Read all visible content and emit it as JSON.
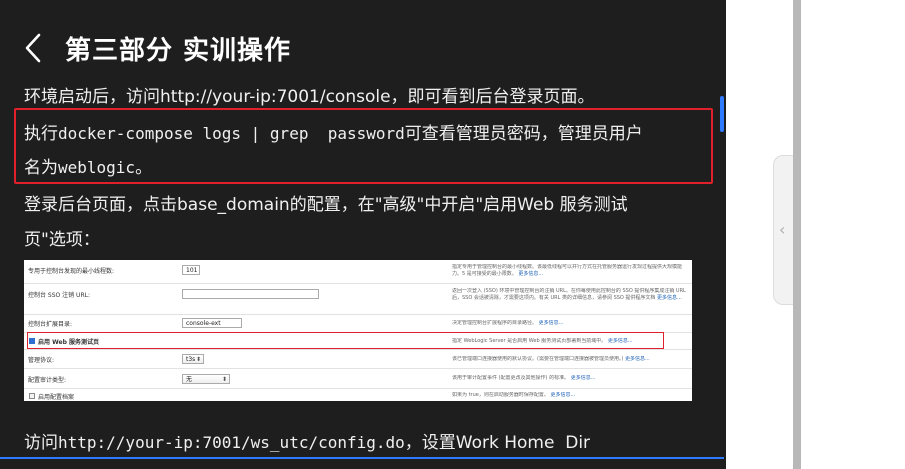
{
  "header": {
    "back_icon": "chevron-left-icon",
    "title": "第三部分 实训操作"
  },
  "content": {
    "line1": "环境启动后，访问http://your-ip:7001/console，即可看到后台登录页面。",
    "line2a": "执行",
    "line2b": "docker-compose logs | grep  password",
    "line2c": "可查看管理员密码，管理员用户",
    "line3a": "名为",
    "line3b": "weblogic",
    "line3c": "。",
    "line4": "登录后台页面，点击base_domain的配置，在\"高级\"中开启\"启用Web  服务测试",
    "line5": "页\"选项：",
    "line6a": "访问",
    "line6b": "http://your-ip:7001/ws_utc/config.do",
    "line6c": "，设置Work Home  Dir"
  },
  "screenshot": {
    "rows": [
      {
        "label": "专用于控制台发现的最小线程数:",
        "value": "101",
        "desc": "指定专用于管理控制台的最小线程数。该最低线程可以并行方式在托管服务器运行发现过程提供大规模能力。5 是可接受的最小限数。",
        "more": "更多信息..."
      },
      {
        "label": "控制台 SSO 注销 URL:",
        "value": "",
        "desc": "返回一次登入 (SSO) 环境中管理控制台的注销 URL。在你每使用此控制台的 SSO 提供程序集成注销 URL 后，SSO 会话被清除，才需要这项内。有关 URL 类的详细信息，请参阅 SSO 提供程序文档",
        "more": "更多信息..."
      },
      {
        "label": "控制台扩展目录:",
        "value": "console-ext",
        "desc": "决定管理控制台扩展程序的目录路径。",
        "more": "更多信息..."
      },
      {
        "label": "启用 Web 服务测试页",
        "value": "",
        "desc": "指定 WebLogic Server 是否启用 Web 服务测试页部署到当前域中。",
        "more": "更多信息..."
      },
      {
        "label": "管理协议:",
        "value": "t3s",
        "desc": "该已管理端口连接器使用的默认协议。(需要在管理端口连接器被管理员使用。)",
        "more": "更多信息..."
      },
      {
        "label": "配置审计类型:",
        "value": "无",
        "desc": "该用于审计配置事件 (配置更改及其他操作) 的标准。",
        "more": "更多信息..."
      },
      {
        "label": "启用配置档案",
        "value": "",
        "desc": "如果为 true，则在启动服务器时保存配置。",
        "more": "更多信息..."
      }
    ]
  },
  "colors": {
    "accent": "#2f7bff",
    "highlight": "#e0202a",
    "background": "#1e1e1e"
  },
  "sidebar": {
    "collapse_icon": "chevron-left-icon"
  }
}
